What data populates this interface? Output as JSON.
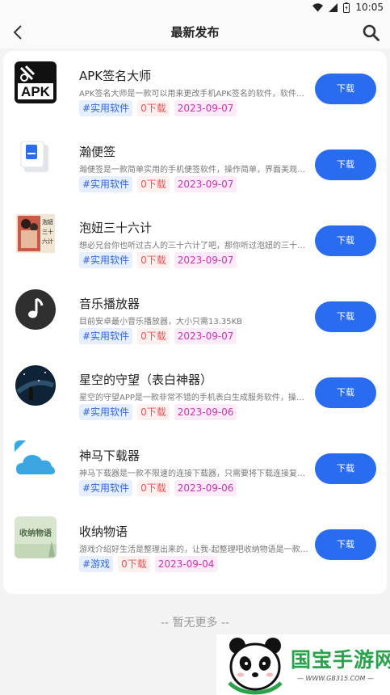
{
  "status": {
    "time": "10:05"
  },
  "header": {
    "title": "最新发布"
  },
  "apps": [
    {
      "name": "APK签名大师",
      "desc": "APK签名大师是一款可以用来更改手机APK签名的软件，软件功能丰富",
      "category": "#实用软件",
      "downloads": "0下载",
      "date": "2023-09-07",
      "button": "下载",
      "icon": "apk-signature-icon"
    },
    {
      "name": "瀚便签",
      "desc": "瀚便签是一款简单实用的手机便签软件，操作简单，界面美观大方",
      "category": "#实用软件",
      "downloads": "0下载",
      "date": "2023-09-07",
      "button": "下载",
      "icon": "notepad-icon"
    },
    {
      "name": "泡妞三十六计",
      "desc": "想必兄台你也听过古人的三十六计了吧，那你听过泡妞的三十六计吗",
      "category": "#实用软件",
      "downloads": "0下载",
      "date": "2023-09-07",
      "button": "下载",
      "icon": "book-cover-icon"
    },
    {
      "name": "音乐播放器",
      "desc": "目前安卓最小音乐播放器，大小只需13.35KB",
      "category": "#实用软件",
      "downloads": "0下载",
      "date": "2023-09-07",
      "button": "下载",
      "icon": "music-note-icon"
    },
    {
      "name": "星空的守望（表白神器）",
      "desc": "星空的守望APP是一款非常不错的手机表白生成服务软件，操作简单",
      "category": "#实用软件",
      "downloads": "0下载",
      "date": "2023-09-06",
      "button": "下载",
      "icon": "starry-sky-icon"
    },
    {
      "name": "神马下载器",
      "desc": "神马下载器是一款不限速的连接下载器，只需要将下载连接复制进来即可",
      "category": "#实用软件",
      "downloads": "0下载",
      "date": "2023-09-06",
      "button": "下载",
      "icon": "cloud-icon"
    },
    {
      "name": "收纳物语",
      "desc": "游戏介绍好生活是整理出来的，让我-起整理吧收纳物语是一款模拟游戏",
      "category": "#游戏",
      "downloads": "0下载",
      "date": "2023-09-04",
      "button": "下载",
      "icon": "storage-game-icon"
    }
  ],
  "footer": {
    "no_more": "-- 暂无更多 --"
  },
  "watermark": {
    "brand": "国宝手游网",
    "url": "— WWW.GB315.COM —"
  },
  "colors": {
    "accent": "#2a6cf0",
    "category_tag": "#3366dd",
    "downloads_tag": "#e65454",
    "date_tag": "#c935b7"
  }
}
